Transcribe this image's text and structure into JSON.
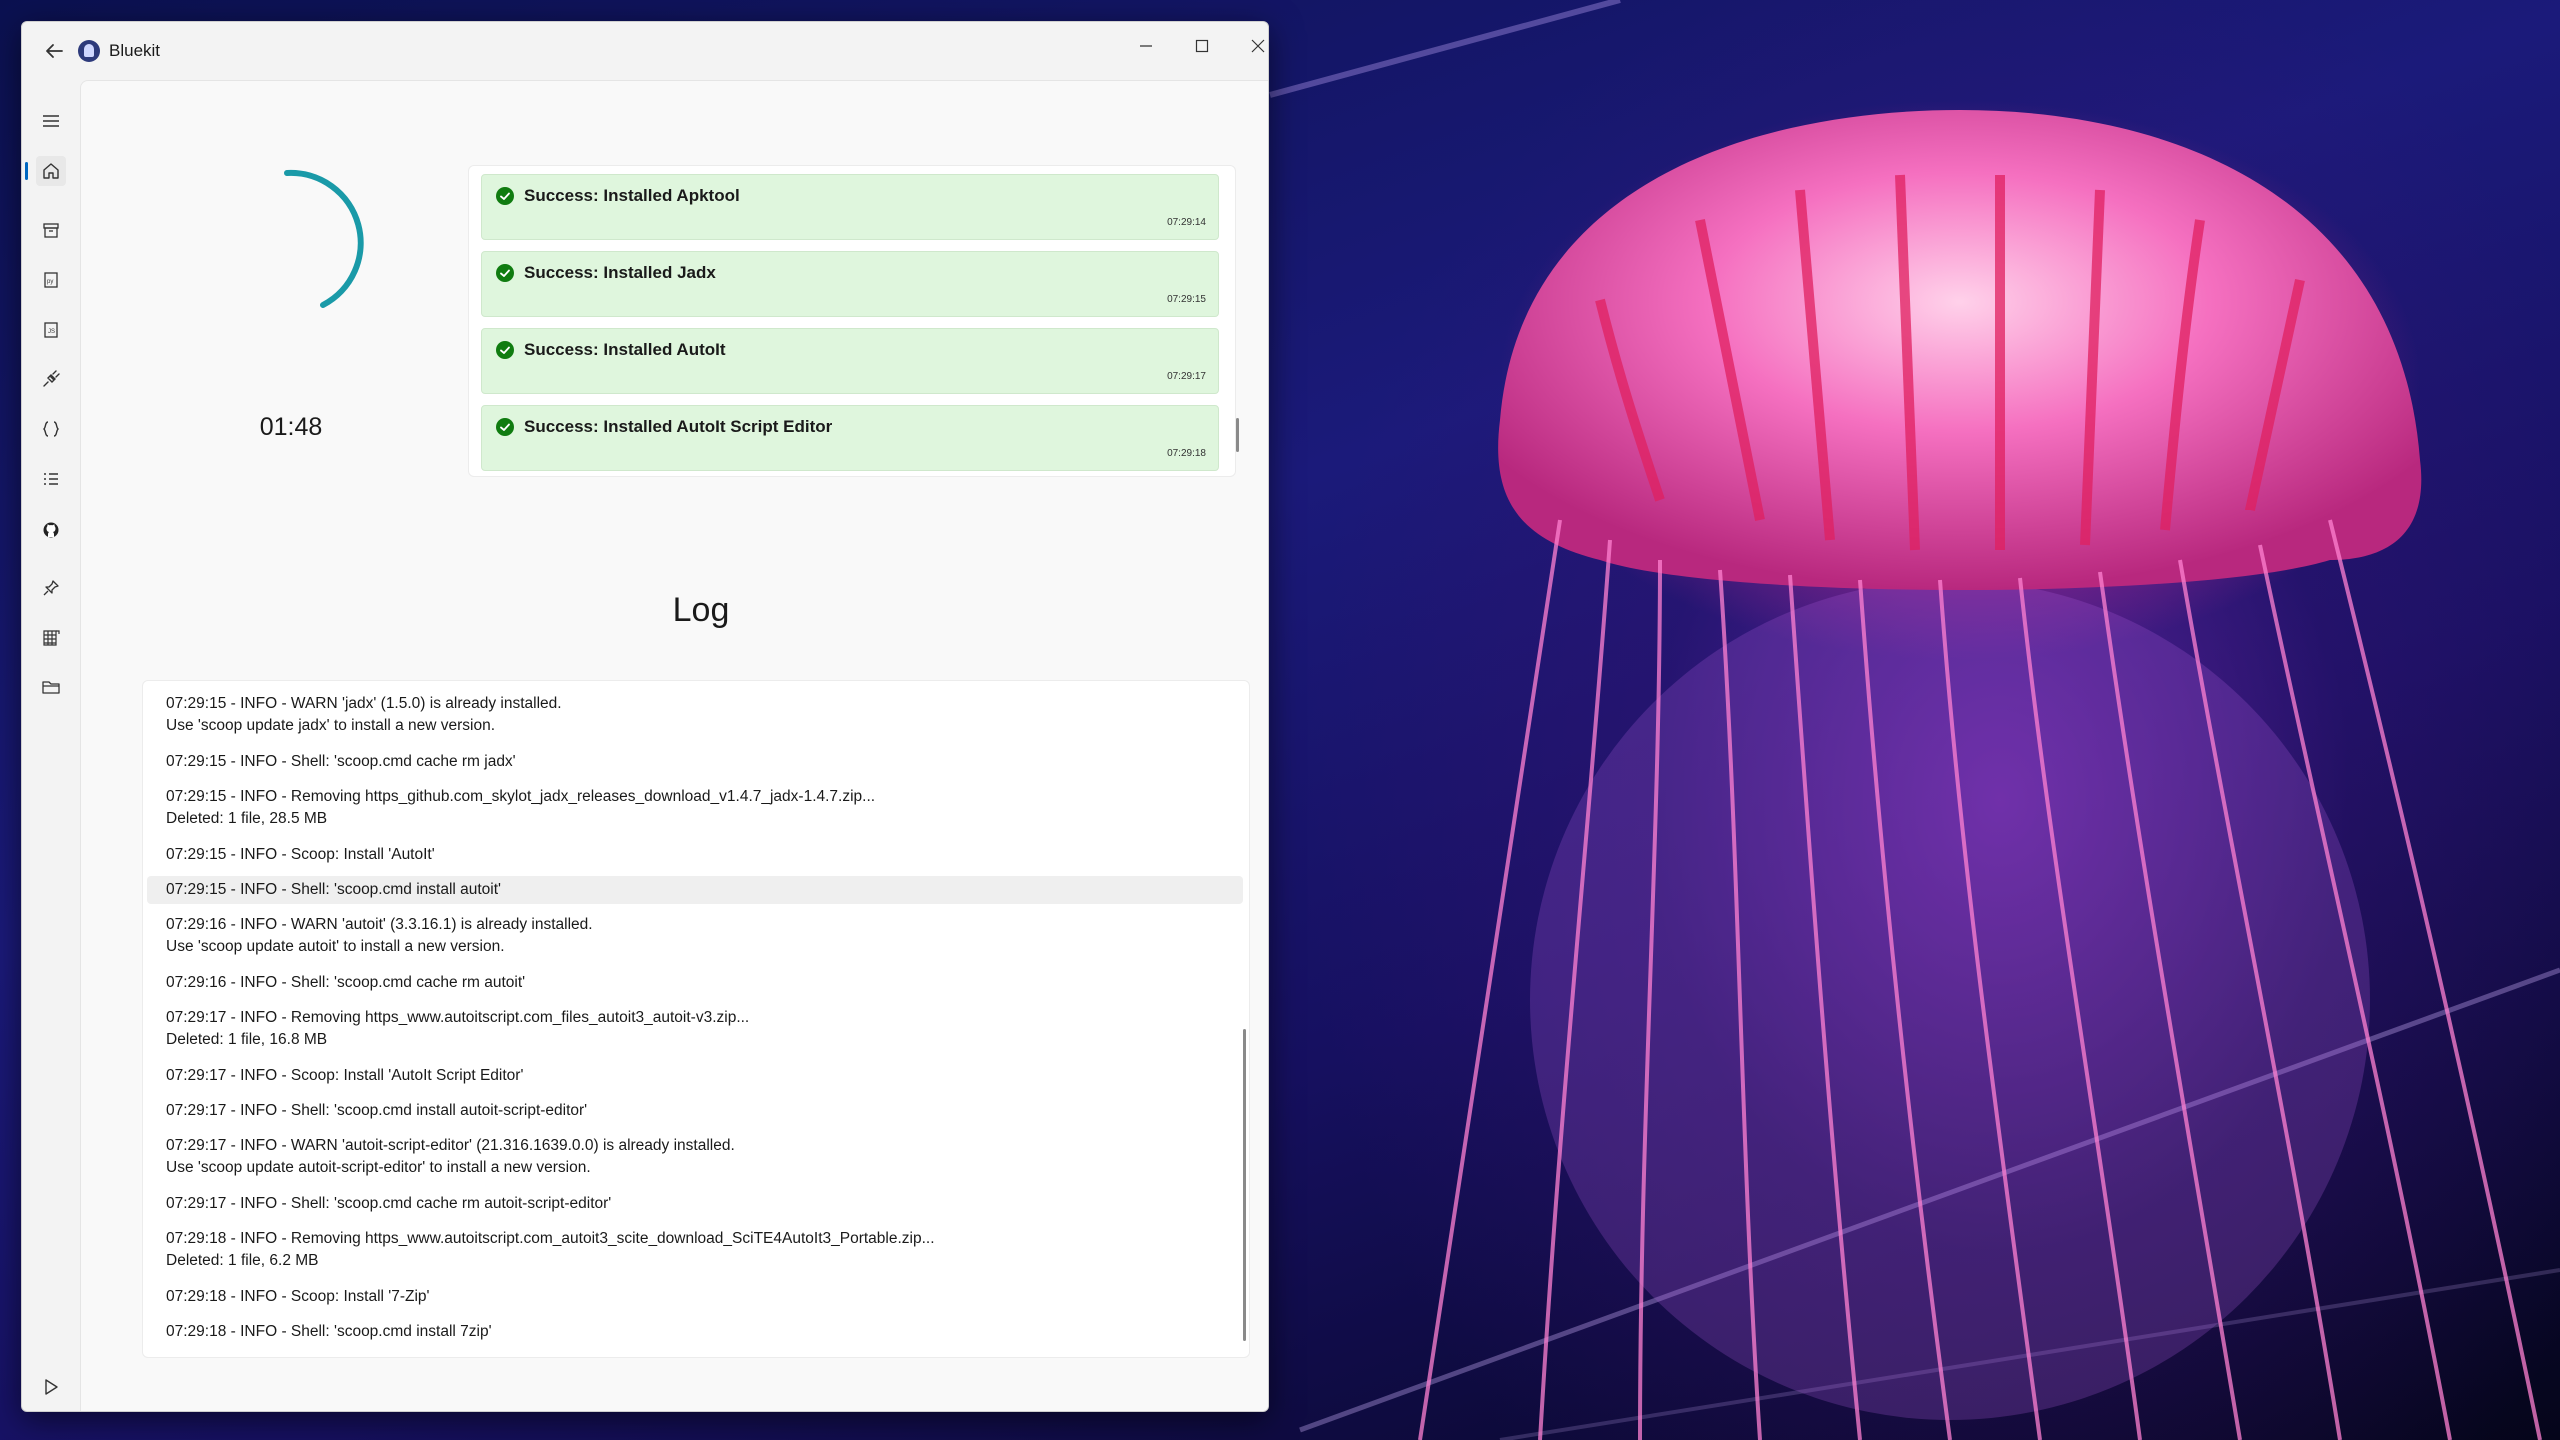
{
  "window": {
    "title": "Bluekit"
  },
  "sidebar": {
    "items": [
      {
        "name": "menu",
        "icon": "hamburger-icon"
      },
      {
        "name": "home",
        "icon": "home-icon",
        "active": true
      },
      {
        "name": "store",
        "icon": "store-icon"
      },
      {
        "name": "python",
        "icon": "python-file-icon"
      },
      {
        "name": "javascript",
        "icon": "javascript-file-icon"
      },
      {
        "name": "tools",
        "icon": "plug-icon"
      },
      {
        "name": "code",
        "icon": "braces-icon"
      },
      {
        "name": "tasks",
        "icon": "checklist-icon"
      },
      {
        "name": "github",
        "icon": "github-icon"
      },
      {
        "name": "pin",
        "icon": "pin-icon"
      },
      {
        "name": "apps",
        "icon": "apps-grid-icon"
      },
      {
        "name": "folder",
        "icon": "folder-icon"
      },
      {
        "name": "run",
        "icon": "play-icon"
      }
    ]
  },
  "progress": {
    "timer": "01:48"
  },
  "notifications": [
    {
      "message": "Success: Installed Apktool",
      "time": "07:29:14"
    },
    {
      "message": "Success: Installed Jadx",
      "time": "07:29:15"
    },
    {
      "message": "Success: Installed AutoIt",
      "time": "07:29:17"
    },
    {
      "message": "Success: Installed AutoIt Script Editor",
      "time": "07:29:18"
    }
  ],
  "log": {
    "title": "Log",
    "entries": [
      {
        "line1": "07:29:15 - INFO - WARN  'jadx' (1.5.0) is already installed.",
        "line2": "Use 'scoop update jadx' to install a new version."
      },
      {
        "line1": "07:29:15 - INFO - Shell: 'scoop.cmd cache rm jadx'",
        "line2": ""
      },
      {
        "line1": "07:29:15 - INFO - Removing https_github.com_skylot_jadx_releases_download_v1.4.7_jadx-1.4.7.zip...",
        "line2": "Deleted: 1 file, 28.5 MB"
      },
      {
        "line1": "07:29:15 - INFO - Scoop: Install 'AutoIt'",
        "line2": ""
      },
      {
        "line1": "07:29:15 - INFO - Shell: 'scoop.cmd install autoit'",
        "line2": "",
        "selected": true
      },
      {
        "line1": "07:29:16 - INFO - WARN  'autoit' (3.3.16.1) is already installed.",
        "line2": "Use 'scoop update autoit' to install a new version."
      },
      {
        "line1": "07:29:16 - INFO - Shell: 'scoop.cmd cache rm autoit'",
        "line2": ""
      },
      {
        "line1": "07:29:17 - INFO - Removing https_www.autoitscript.com_files_autoit3_autoit-v3.zip...",
        "line2": "Deleted: 1 file, 16.8 MB"
      },
      {
        "line1": "07:29:17 - INFO - Scoop: Install 'AutoIt Script Editor'",
        "line2": ""
      },
      {
        "line1": "07:29:17 - INFO - Shell: 'scoop.cmd install autoit-script-editor'",
        "line2": ""
      },
      {
        "line1": "07:29:17 - INFO - WARN  'autoit-script-editor' (21.316.1639.0.0) is already installed.",
        "line2": "Use 'scoop update autoit-script-editor' to install a new version."
      },
      {
        "line1": "07:29:17 - INFO - Shell: 'scoop.cmd cache rm autoit-script-editor'",
        "line2": ""
      },
      {
        "line1": "07:29:18 - INFO - Removing https_www.autoitscript.com_autoit3_scite_download_SciTE4AutoIt3_Portable.zip...",
        "line2": "Deleted: 1 file, 6.2 MB"
      },
      {
        "line1": "07:29:18 - INFO - Scoop: Install '7-Zip'",
        "line2": ""
      },
      {
        "line1": "07:29:18 - INFO - Shell: 'scoop.cmd install 7zip'",
        "line2": ""
      }
    ]
  },
  "colors": {
    "accent": "#0067c0",
    "spinner": "#1a9aa8",
    "success_bg": "#dff6dd",
    "success_icon": "#107c10"
  }
}
